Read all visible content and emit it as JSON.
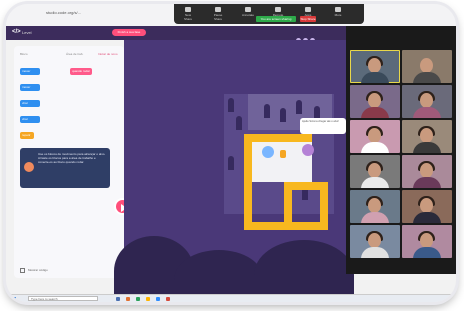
{
  "browser": {
    "url": "studio.code.org/s/...",
    "share_status": "You are screen sharing",
    "stop_label": "Stop Share"
  },
  "zoom_toolbar": {
    "tools": [
      "New Share",
      "Pause Share",
      "Annotate",
      "Remote Control",
      "Apps",
      "More"
    ]
  },
  "game_header": {
    "logo": "</>",
    "title": "Level",
    "pink_button": "Finish a sua fase"
  },
  "left_panel": {
    "col1": "Bloco",
    "col2": "Área de trab.",
    "col3": "Iniciar de novo",
    "blocks": [
      "mover",
      "mover",
      "virar",
      "virar",
      "repetir"
    ],
    "when_run": "quando rodar",
    "tooltip": "Use os blocos de movimento para alcançar o alvo. Arraste os blocos para a área de trabalho e conecte-os ao bloco quando rodar.",
    "checkbox_label": "Mostrar código"
  },
  "game": {
    "speech": "Ajude Scrat a chegar até o alvo!"
  },
  "taskbar": {
    "search_placeholder": "Type here to search"
  },
  "video_panel": {
    "tile_colors": [
      "#5b6a7a",
      "#8a7a6a",
      "#7a6a8a",
      "#6a6a7a",
      "#c99ab0",
      "#9a8a7a",
      "#7a7a7a",
      "#aa8a9a",
      "#6a7a8a",
      "#8a6a5a",
      "#7a8aa0",
      "#b08aa0",
      "#6a6a6a",
      "#9a9a8a"
    ]
  }
}
